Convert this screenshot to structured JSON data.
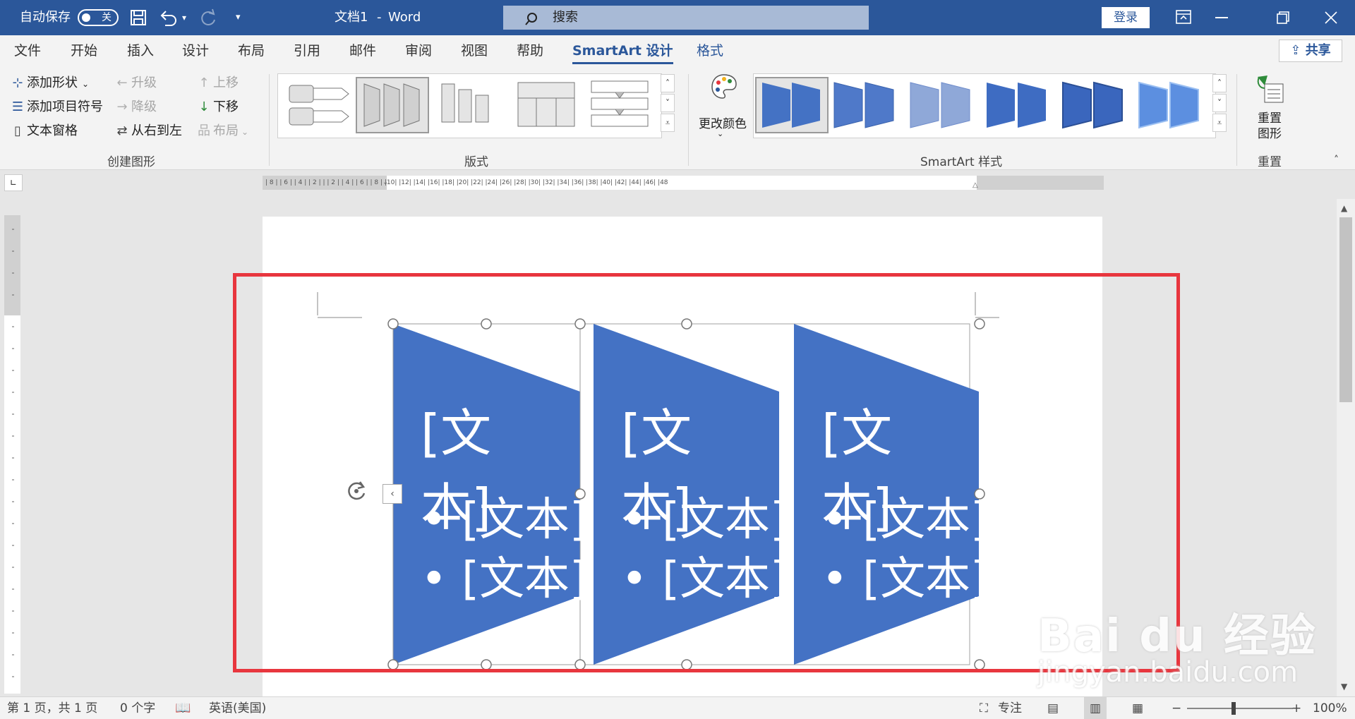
{
  "titlebar": {
    "autosave_label": "自动保存",
    "autosave_state": "关",
    "doc_title": "文档1",
    "app_name": "Word",
    "title_sep": "-",
    "search_placeholder": "搜索",
    "login_label": "登录"
  },
  "menu": [
    "文件",
    "开始",
    "插入",
    "设计",
    "布局",
    "引用",
    "邮件",
    "审阅",
    "视图",
    "帮助",
    "SmartArt 设计",
    "格式"
  ],
  "menu_active": "SmartArt 设计",
  "share_label": "共享",
  "ribbon": {
    "create": {
      "add_shape": "添加形状",
      "add_bullet": "添加项目符号",
      "text_pane": "文本窗格",
      "promote": "升级",
      "demote": "降级",
      "right_to_left": "从右到左",
      "move_up": "上移",
      "move_down": "下移",
      "layout": "布局",
      "group_label": "创建图形"
    },
    "layouts_group_label": "版式",
    "change_colors": "更改颜色",
    "styles_group_label": "SmartArt 样式",
    "reset_graphic_1": "重置",
    "reset_graphic_2": "图形",
    "reset_group_label": "重置"
  },
  "ruler": {
    "ticks": "| 8 |  | 6 |  | 4 |  | 2 |    |    | 2 |  | 4 |  | 6 |  | 8 |  |10|  |12|  |14|  |16|  |18|  |20|  |22|  |24|  |26|  |28|  |30|  |32|  |34|  |36|  |38|  |40|  |42|  |44|  |46|  |48"
  },
  "smartart": {
    "shapes": [
      {
        "title": "[文本]",
        "bullets": [
          "[文本]",
          "[文本]"
        ]
      },
      {
        "title": "[文本]",
        "bullets": [
          "[文本]",
          "[文本]"
        ]
      },
      {
        "title": "[文本]",
        "bullets": [
          "[文本]",
          "[文本]"
        ]
      }
    ],
    "fill_color": "#4472c4",
    "highlight_color": "#e8363e"
  },
  "status": {
    "page": "第 1 页，共 1 页",
    "words": "0 个字",
    "language": "英语(美国)",
    "focus": "专注",
    "zoom": "100%"
  },
  "watermark": {
    "main": "Bai du 经验",
    "url": "jingyan.baidu.com"
  }
}
